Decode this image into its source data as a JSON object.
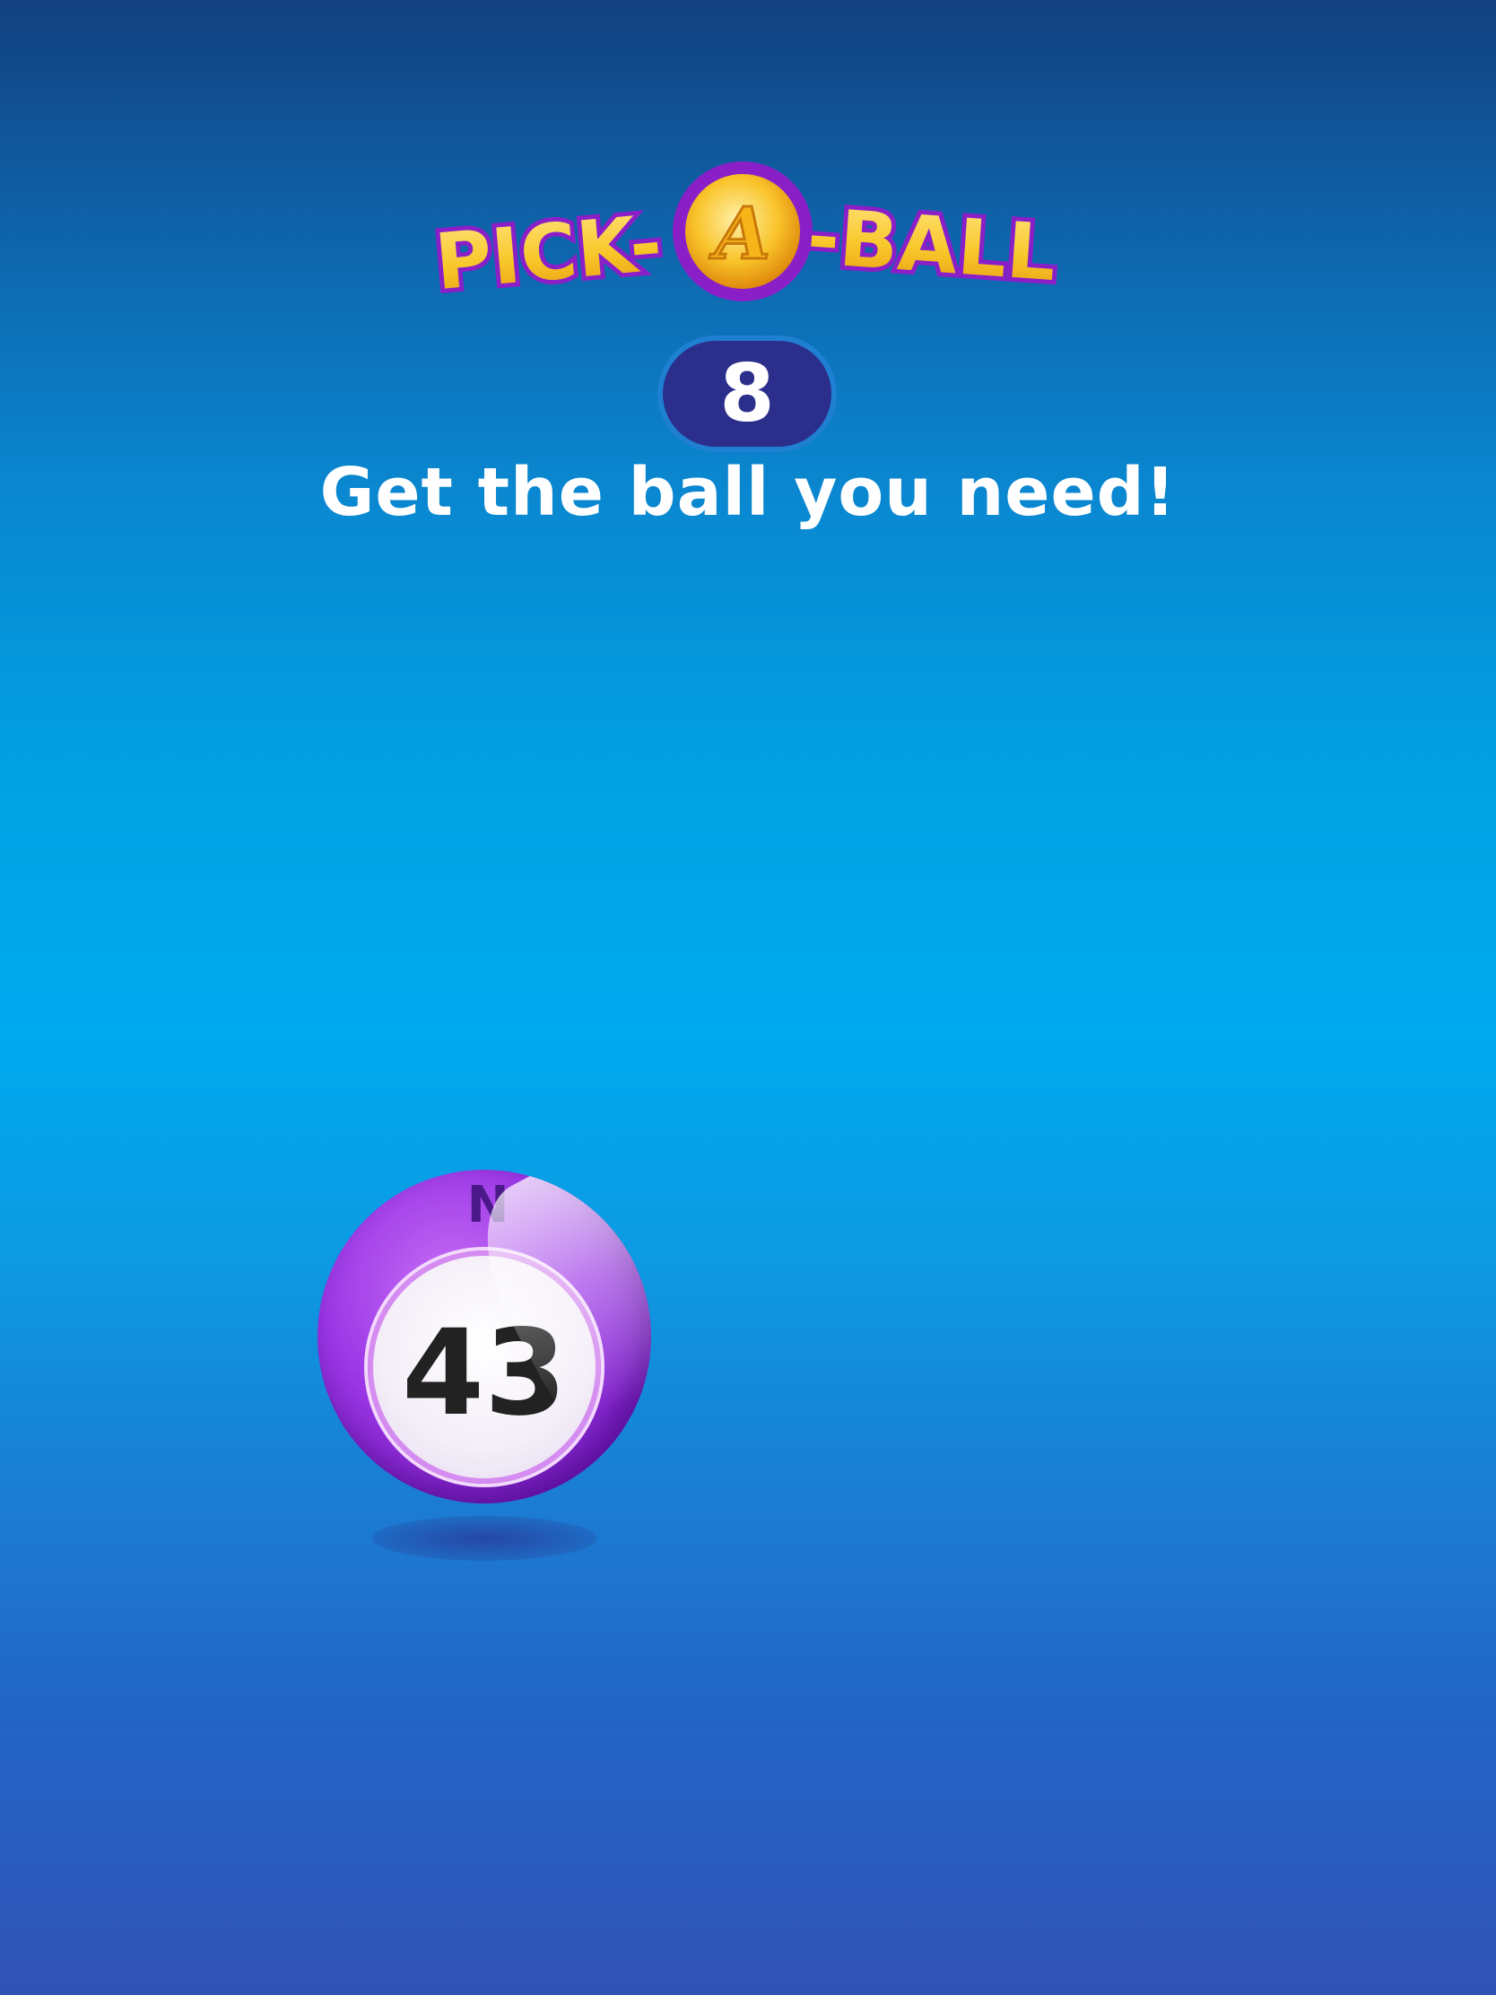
{
  "logo": {
    "text_left": "PICK-",
    "text_center": "A",
    "text_right": "-BALL"
  },
  "counter": {
    "value": "8"
  },
  "prompt": {
    "text": "Get the ball you need!"
  },
  "ball": {
    "letter": "N",
    "number": "43",
    "color": "#9b36e6"
  },
  "colors": {
    "background_top": "#12407f",
    "background_mid": "#00aaef",
    "background_bottom": "#3152b5",
    "logo_gold": "#f8c72a",
    "logo_outline": "#8a1fc8",
    "counter_bg": "#2c2e8c"
  }
}
